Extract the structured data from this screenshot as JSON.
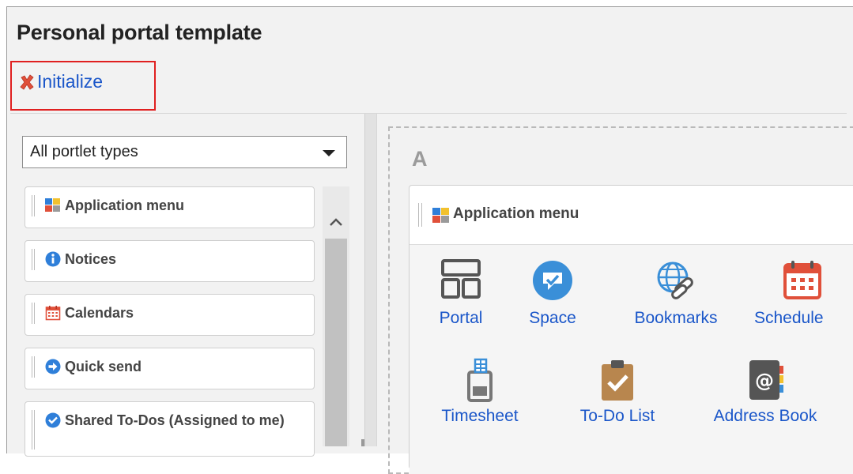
{
  "page": {
    "title": "Personal portal template",
    "initialize_label": "Initialize"
  },
  "left_panel": {
    "select_value": "All portlet types",
    "portlets": [
      {
        "label": "Application menu",
        "icon": "application-menu-icon"
      },
      {
        "label": "Notices",
        "icon": "info-icon"
      },
      {
        "label": "Calendars",
        "icon": "calendar-icon"
      },
      {
        "label": "Quick send",
        "icon": "arrow-right-icon"
      },
      {
        "label": "Shared To-Dos (Assigned to me)",
        "icon": "check-bubble-icon"
      }
    ]
  },
  "layout": {
    "zone_label": "A",
    "portlet_title": "Application menu",
    "apps": [
      {
        "label": "Portal",
        "icon": "portal-icon"
      },
      {
        "label": "Space",
        "icon": "space-icon"
      },
      {
        "label": "Bookmarks",
        "icon": "bookmarks-icon"
      },
      {
        "label": "Schedule",
        "icon": "schedule-icon"
      },
      {
        "label": "Timesheet",
        "icon": "timesheet-icon"
      },
      {
        "label": "To-Do List",
        "icon": "todo-list-icon"
      },
      {
        "label": "Address Book",
        "icon": "address-book-icon"
      }
    ]
  },
  "colors": {
    "link": "#1a56c9",
    "highlight_border": "#e02020",
    "initialize_x": "#e0503a"
  }
}
